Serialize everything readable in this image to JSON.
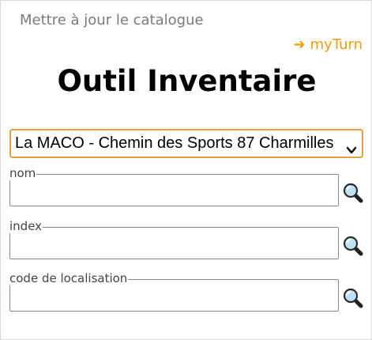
{
  "header": {
    "update_catalog_link": "Mettre à jour le catalogue",
    "myturn_arrow": "➜",
    "myturn_link": "myTurn"
  },
  "page": {
    "title": "Outil Inventaire"
  },
  "location_select": {
    "selected_value": "La MACO - Chemin des Sports 87 Charmilles"
  },
  "fields": [
    {
      "legend": "nom",
      "value": "",
      "placeholder": ""
    },
    {
      "legend": "index",
      "value": "",
      "placeholder": ""
    },
    {
      "legend": "code de localisation",
      "value": "",
      "placeholder": ""
    }
  ],
  "colors": {
    "accent_orange": "#f39c12",
    "select_border": "#e0a43a",
    "muted_text": "#7a7a7a",
    "field_border": "#8a8a8a"
  },
  "icons": {
    "search": "search-icon",
    "select_chevron": "chevron-down-icon",
    "myturn_arrow": "arrow-right-icon"
  }
}
